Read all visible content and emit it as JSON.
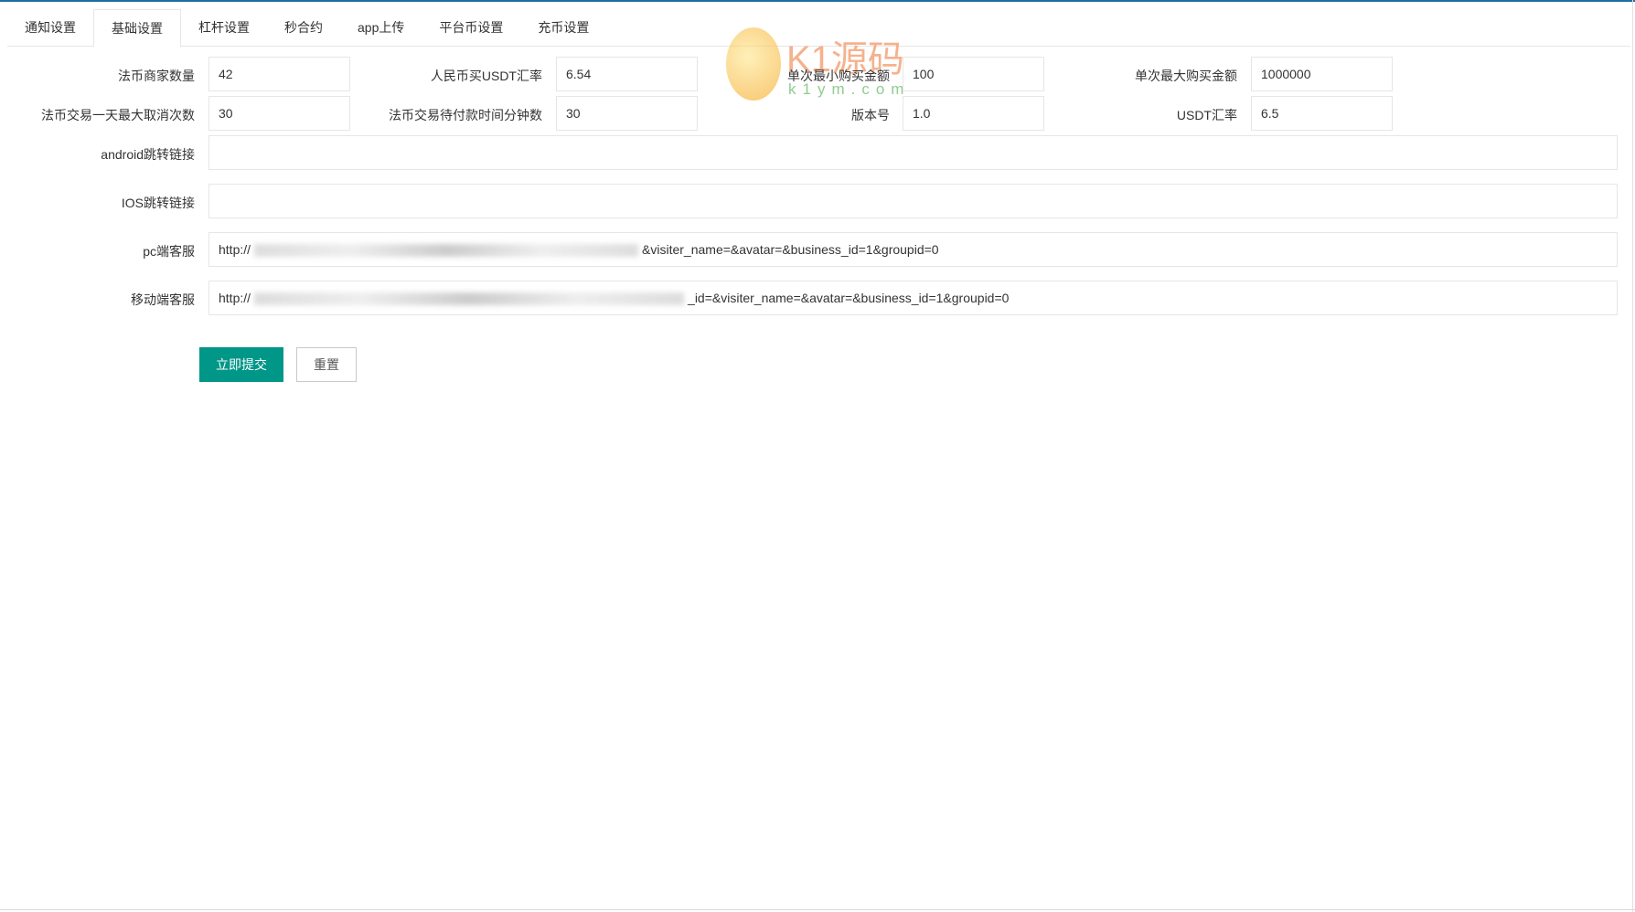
{
  "tabs": [
    "通知设置",
    "基础设置",
    "杠杆设置",
    "秒合约",
    "app上传",
    "平台币设置",
    "充币设置"
  ],
  "active_tab": "基础设置",
  "fields": {
    "merchant_count": {
      "label": "法币商家数量",
      "value": "42"
    },
    "cny_usdt_rate": {
      "label": "人民币买USDT汇率",
      "value": "6.54"
    },
    "min_buy": {
      "label": "单次最小购买金额",
      "value": "100"
    },
    "max_buy": {
      "label": "单次最大购买金额",
      "value": "1000000"
    },
    "max_cancel": {
      "label": "法币交易一天最大取消次数",
      "value": "30"
    },
    "pay_wait": {
      "label": "法币交易待付款时间分钟数",
      "value": "30"
    },
    "version": {
      "label": "版本号",
      "value": "1.0"
    },
    "usdt_rate": {
      "label": "USDT汇率",
      "value": "6.5"
    },
    "android_link": {
      "label": "android跳转链接",
      "value": ""
    },
    "ios_link": {
      "label": "IOS跳转链接",
      "value": ""
    },
    "pc_service": {
      "label": "pc端客服",
      "prefix": "http://",
      "suffix": "&visiter_name=&avatar=&business_id=1&groupid=0"
    },
    "mobile_service": {
      "label": "移动端客服",
      "prefix": "http://",
      "suffix": "_id=&visiter_name=&avatar=&business_id=1&groupid=0"
    }
  },
  "buttons": {
    "submit": "立即提交",
    "reset": "重置"
  },
  "watermark": {
    "logo": "K1源码",
    "url": "k1ym.com"
  },
  "colors": {
    "primary": "#009688"
  }
}
